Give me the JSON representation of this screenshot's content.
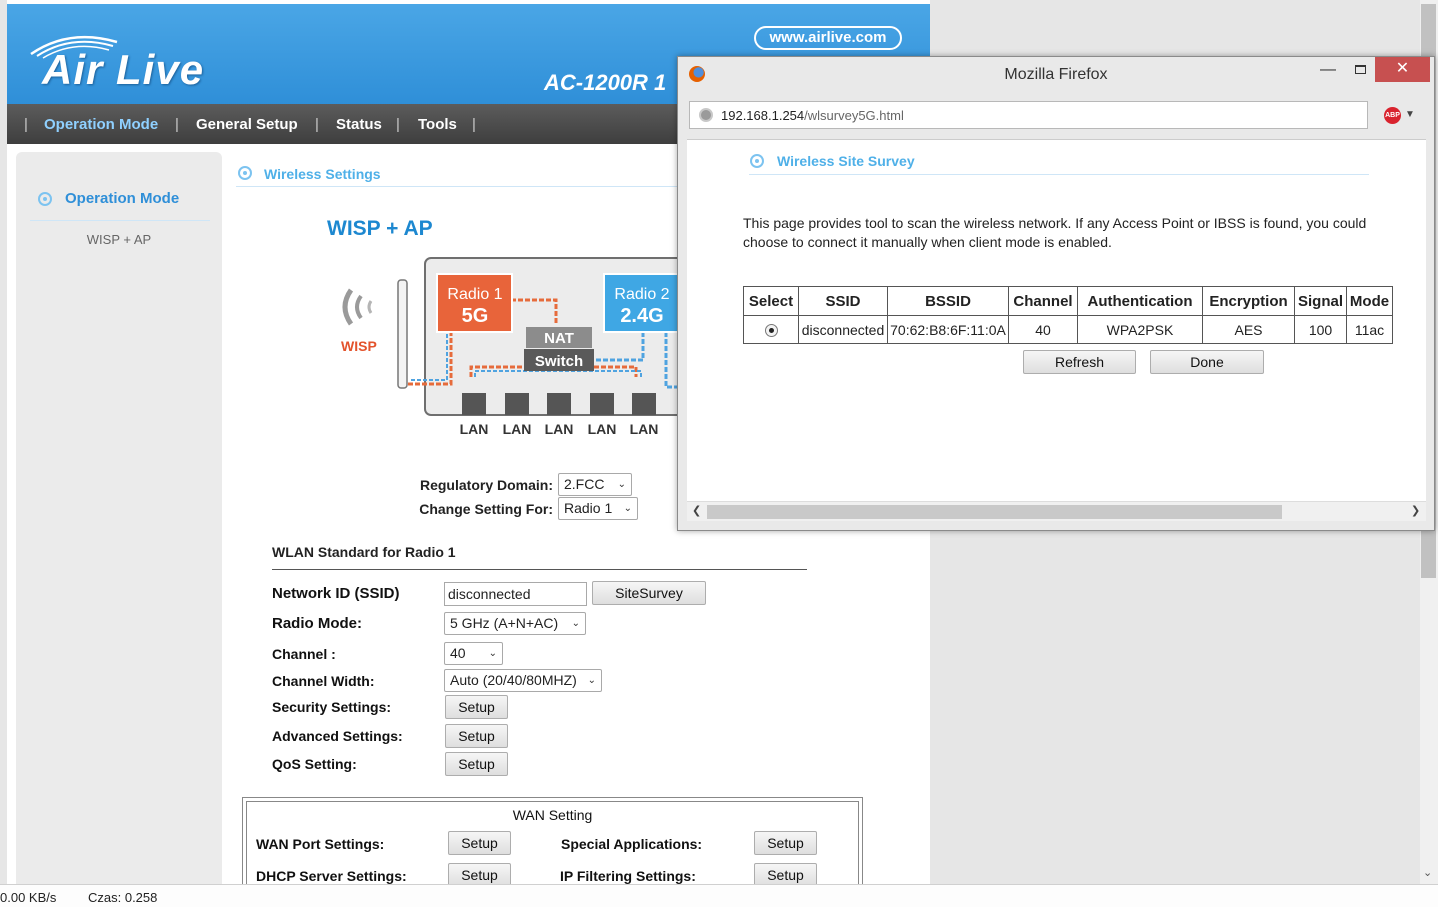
{
  "router": {
    "site_url": "www.airlive.com",
    "logo": "Air Live",
    "model": "AC-1200R 1",
    "nav": [
      "Operation Mode",
      "General Setup",
      "Status",
      "Tools"
    ],
    "sidebar": {
      "title": "Operation Mode",
      "sub": "WISP + AP"
    },
    "section_title": "Wireless Settings",
    "mode_title": "WISP + AP",
    "diagram": {
      "wisp": "WISP",
      "radio1_a": "Radio 1",
      "radio1_b": "5G",
      "radio2_a": "Radio 2",
      "radio2_b": "2.4G",
      "nat": "NAT",
      "switch": "Switch",
      "lan": [
        "LAN",
        "LAN",
        "LAN",
        "LAN",
        "LAN"
      ]
    },
    "regulatory_label": "Regulatory Domain:",
    "regulatory_value": "2.FCC",
    "change_label": "Change Setting For:",
    "change_value": "Radio 1",
    "wlan_title": "WLAN Standard for Radio 1",
    "ssid_label": "Network ID (SSID)",
    "ssid_value": "disconnected",
    "sitesurvey_btn": "SiteSurvey",
    "radio_mode_label": "Radio Mode:",
    "radio_mode_value": "5 GHz (A+N+AC)",
    "channel_label": "Channel :",
    "channel_value": "40",
    "width_label": "Channel Width:",
    "width_value": "Auto (20/40/80MHZ)",
    "security_label": "Security Settings:",
    "advanced_label": "Advanced Settings:",
    "qos_label": "QoS Setting:",
    "setup_btn": "Setup",
    "wan": {
      "title": "WAN Setting",
      "port_label": "WAN Port Settings:",
      "special_label": "Special Applications:",
      "dhcp_label": "DHCP Server Settings:",
      "ipfilter_label": "IP Filtering Settings:"
    }
  },
  "firefox": {
    "title": "Mozilla Firefox",
    "url_host": "192.168.1.254",
    "url_path": "/wlsurvey5G.html",
    "abp": "ABP",
    "survey_title": "Wireless Site Survey",
    "description": "This page provides tool to scan the wireless network. If any Access Point or IBSS is found, you could choose to connect it manually when client mode is enabled.",
    "columns": [
      "Select",
      "SSID",
      "BSSID",
      "Channel",
      "Authentication",
      "Encryption",
      "Signal",
      "Mode"
    ],
    "rows": [
      {
        "ssid": "disconnected",
        "bssid": "70:62:B8:6F:11:0A",
        "channel": "40",
        "auth": "WPA2PSK",
        "enc": "AES",
        "signal": "100",
        "mode": "11ac"
      }
    ],
    "refresh_btn": "Refresh",
    "done_btn": "Done"
  },
  "status": {
    "speed": "0.00 KB/s",
    "time": "Czas: 0.258"
  }
}
